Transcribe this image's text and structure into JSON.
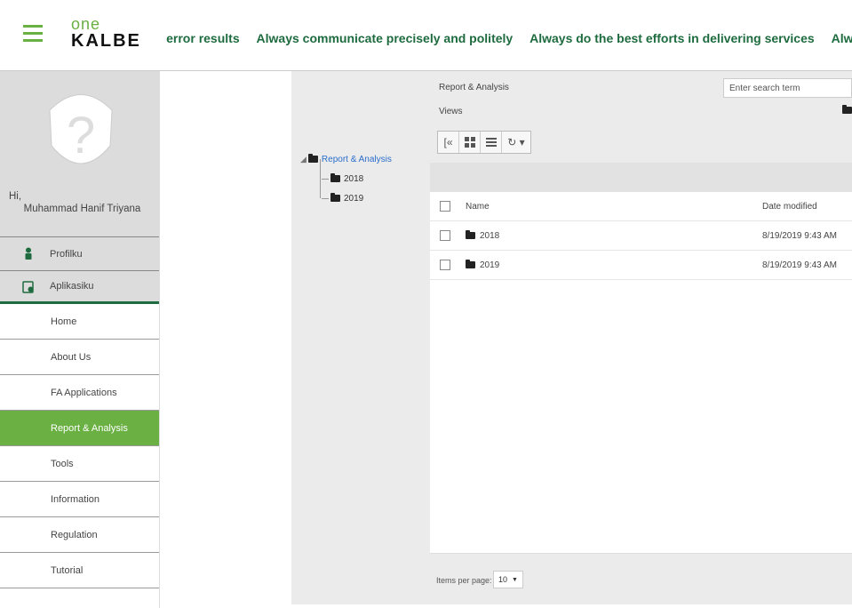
{
  "header": {
    "logo_one": "one",
    "logo_kalbe": "KALBE",
    "marquee": "d zero error results     Always communicate precisely and politely     Always do the best efforts in delivering services     Alwa"
  },
  "profile": {
    "greeting": "Hi,",
    "name": "Muhammad Hanif Triyana"
  },
  "sidebar": {
    "sections": [
      {
        "label": "Profilku"
      },
      {
        "label": "Aplikasiku"
      }
    ],
    "items": [
      {
        "label": "Home"
      },
      {
        "label": "About Us"
      },
      {
        "label": "FA Applications"
      },
      {
        "label": "Report & Analysis"
      },
      {
        "label": "Tools"
      },
      {
        "label": "Information"
      },
      {
        "label": "Regulation"
      },
      {
        "label": "Tutorial"
      }
    ],
    "active": "Report & Analysis"
  },
  "tree": {
    "root": "Report & Analysis",
    "children": [
      "2018",
      "2019"
    ]
  },
  "main": {
    "breadcrumb": "Report & Analysis",
    "search_placeholder": "Enter search term",
    "views_label": "Views",
    "columns": {
      "name": "Name",
      "date": "Date modified"
    },
    "rows": [
      {
        "name": "2018",
        "date": "8/19/2019 9:43 AM"
      },
      {
        "name": "2019",
        "date": "8/19/2019 9:43 AM"
      }
    ],
    "pager_label": "Items per page:",
    "pager_value": "10"
  },
  "colors": {
    "accent": "#6ab043",
    "marquee_text": "#1e6b3f",
    "tree_link": "#2a6ecb"
  }
}
